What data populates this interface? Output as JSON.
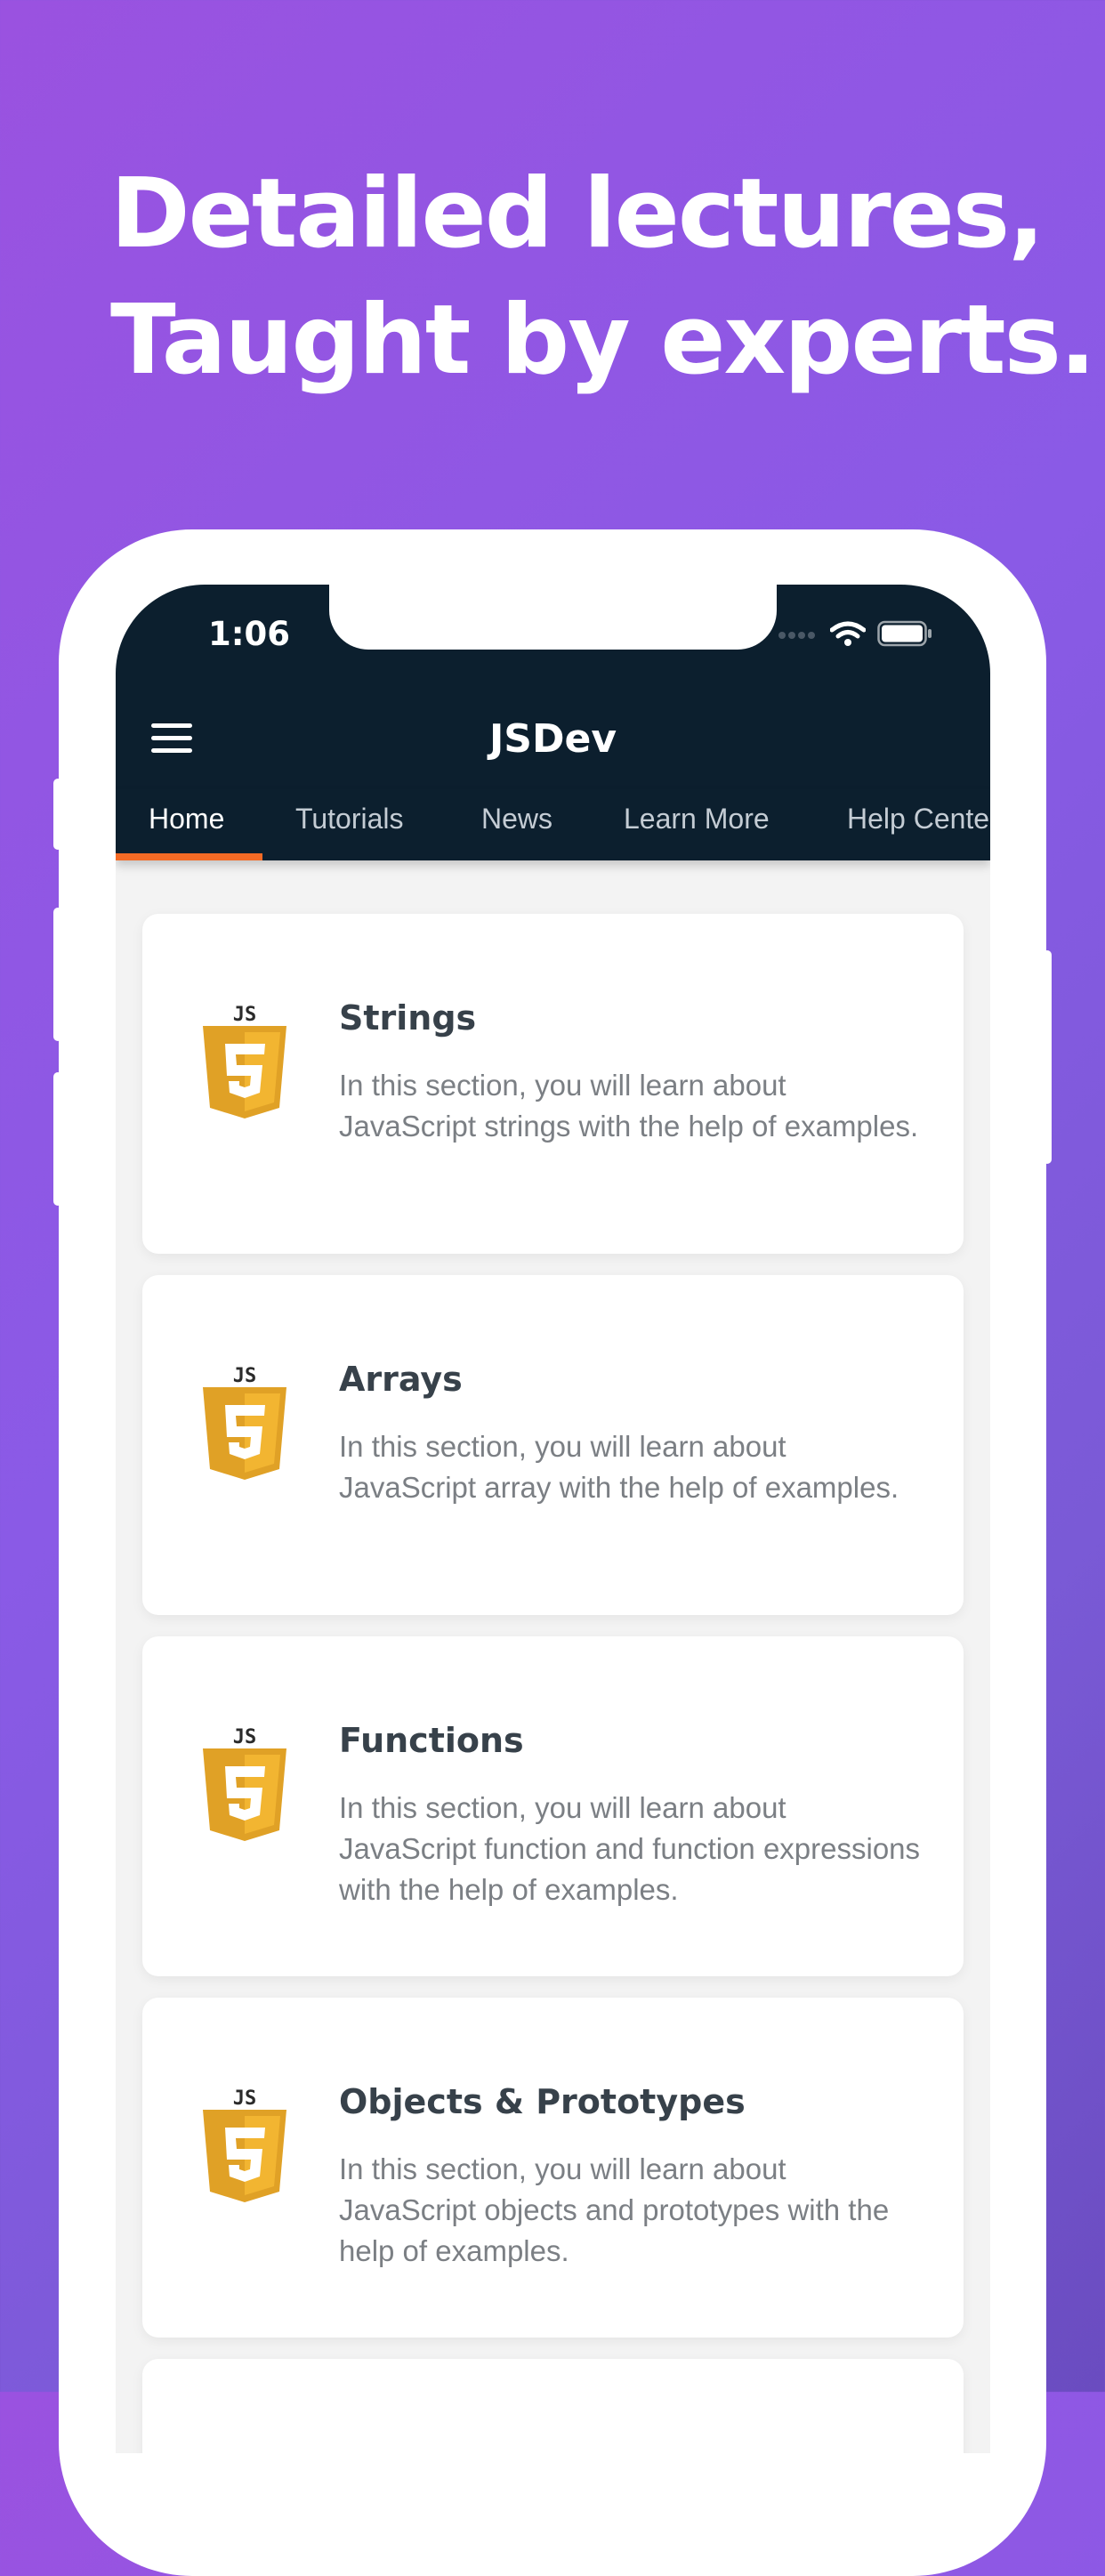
{
  "headline": {
    "line1": "Detailed lectures,",
    "line2": "Taught by experts."
  },
  "status_bar": {
    "time": "1:06"
  },
  "app": {
    "title": "JSDev",
    "accent": "#f46a25",
    "bar_color": "#0c1f2e"
  },
  "tabs": [
    {
      "label": "Home",
      "active": true
    },
    {
      "label": "Tutorials",
      "active": false
    },
    {
      "label": "News",
      "active": false
    },
    {
      "label": "Learn More",
      "active": false
    },
    {
      "label": "Help Center",
      "active": false
    }
  ],
  "cards": [
    {
      "icon": "js-html5-logo-icon",
      "title": "Strings",
      "description": "In this section, you will learn about JavaScript strings with the help of examples."
    },
    {
      "icon": "js-html5-logo-icon",
      "title": "Arrays",
      "description": "In this section, you will learn about JavaScript array with the help of examples."
    },
    {
      "icon": "js-html5-logo-icon",
      "title": "Functions",
      "description": "In this section, you will learn about JavaScript function and function expressions with the help of examples."
    },
    {
      "icon": "js-html5-logo-icon",
      "title": "Objects & Prototypes",
      "description": "In this section, you will learn about JavaScript objects and prototypes with the help of examples."
    }
  ],
  "logo_text": "JS"
}
